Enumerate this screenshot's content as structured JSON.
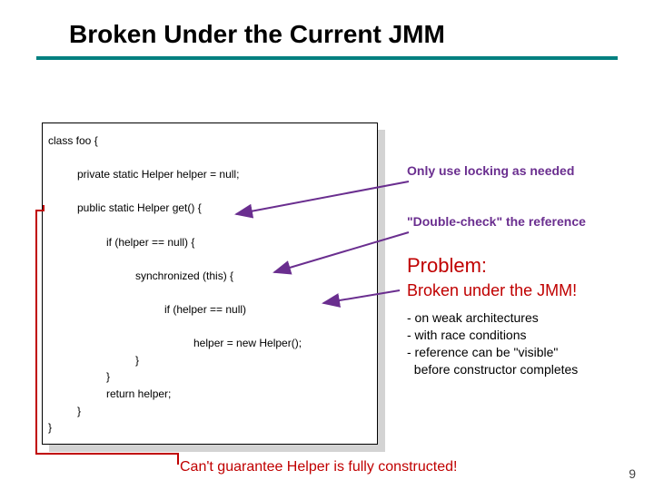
{
  "title": "Broken Under the Current JMM",
  "code": {
    "l1": "class foo {",
    "l2": "private static Helper helper = null;",
    "l3": "public static Helper get() {",
    "l4": "if (helper == null) {",
    "l5": "synchronized (this) {",
    "l6": "if (helper == null)",
    "l7": "helper = new Helper();",
    "l8": "}",
    "l9": "}",
    "l10": "return helper;",
    "l11": "}",
    "l12": "}"
  },
  "annotations": {
    "locking": "Only use locking as needed",
    "doublecheck": "\"Double-check\" the reference",
    "problem_heading": "Problem:",
    "problem_sub": "Broken under the JMM!",
    "bullets": {
      "b1": "- on weak architectures",
      "b2": "- with race conditions",
      "b3": "- reference can be \"visible\"",
      "b4": "  before constructor completes"
    }
  },
  "footnote": "Can't guarantee Helper is fully constructed!",
  "page": "9"
}
